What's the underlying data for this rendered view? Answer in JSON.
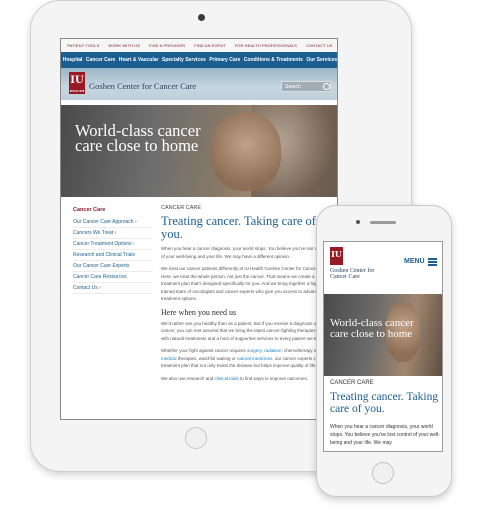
{
  "tablet": {
    "utility_nav": [
      "PATIENT TOOLS",
      "WORK WITH US",
      "FIND A PROVIDER",
      "FIND AN EVENT",
      "FOR HEALTH PROFESSIONALS",
      "CONTACT US"
    ],
    "main_nav": [
      "Hospital",
      "Cancer Care",
      "Heart & Vascular",
      "Specialty Services",
      "Primary Care",
      "Conditions & Treatments",
      "Our Services"
    ],
    "logo_text": "IU",
    "logo_sub": "HEALTH",
    "brand": "Goshen Center for Cancer Care",
    "search_placeholder": "Search",
    "hero_text": "World-class cancer care close to home",
    "sidebar": {
      "title": "Cancer Care",
      "items": [
        "Our Cancer Care Approach ›",
        "Cancers We Treat ›",
        "Cancer Treatment Options ›",
        "Research and Clinical Trials",
        "Our Cancer Care Experts",
        "Cancer Care Resources",
        "Contact Us ›"
      ]
    },
    "main": {
      "label": "CANCER CARE",
      "heading": "Treating cancer. Taking care of you.",
      "p1": "When you hear a cancer diagnosis, your world stops. You believe you've lost control of your well-being and your life. We may have a different opinion.",
      "p2": "We treat our cancer patients differently at IU Health Goshen Center for Cancer Care. Here, we treat the whole person, not just the cancer. That means we create a treatment plan that's designed specifically for you. And we bring together a highly trained team of oncologists and cancer experts who give you access to advanced treatment options.",
      "subheading": "Here when you need us",
      "p3": "We'd rather see you healthy than as a patient. But if you receive a diagnosis of cancer, you can rest assured that we bring the latest cancer-fighting therapies, along with natural treatments and a host of supportive services to every patient we treat.",
      "p4_start": "Whether your fight against cancer requires ",
      "p4_link1": "surgery",
      "p4_sep1": ", ",
      "p4_link2": "radiation",
      "p4_mid": ", chemotherapy or other ",
      "p4_link3": "medical",
      "p4_mid2": " therapies, watchful waiting or ",
      "p4_link4": "natural medicines",
      "p4_end": ", our cancer experts create a treatment plan that not only treats the disease but helps improve quality of life.",
      "p5_start": "We also use research and ",
      "p5_link": "clinical trials",
      "p5_end": " to find ways to improve outcomes."
    }
  },
  "phone": {
    "logo_text": "IU",
    "brand": "Goshen Center for Cancer Care",
    "menu_label": "MENU",
    "hero_text": "World-class cancer care close to home",
    "label": "CANCER CARE",
    "heading": "Treating cancer. Taking care of you.",
    "body": "When you hear a cancer diagnosis, your world stops. You believe you've lost control of your well-being and your life. We may"
  },
  "colors": {
    "nav_blue": "#1b5e8f",
    "brand_red": "#9a1a24",
    "link_blue": "#1b7fc4"
  },
  "icons": [
    "search-icon",
    "menu-icon",
    "camera-icon",
    "home-button-icon"
  ]
}
